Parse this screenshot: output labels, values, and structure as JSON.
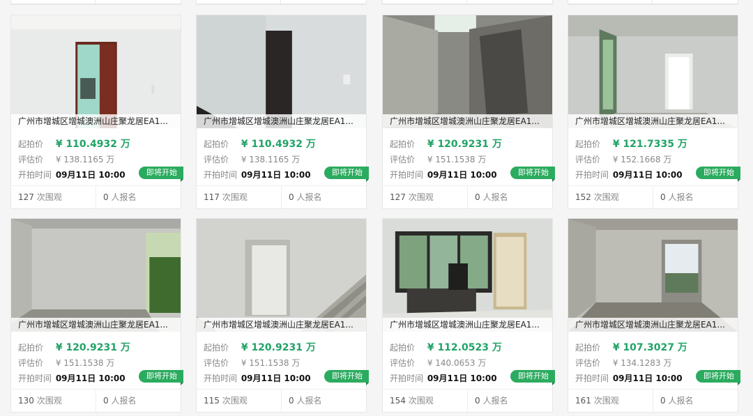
{
  "labels": {
    "start_price": "起拍价",
    "evaluation": "评估价",
    "start_time": "开拍时间",
    "views_suffix": "次围观",
    "signup_suffix": "人报名",
    "status": "即将开始"
  },
  "colors": {
    "accent_green": "#21a366",
    "badge_green": "#2bab5f"
  },
  "listings": [
    {
      "title": "广州市增城区增城澳洲山庄聚龙居EA1...",
      "start_price": "¥ 110.4932 万",
      "evaluation": "¥ 138.1165 万",
      "start_time": "09月11日 10:00",
      "views": "127",
      "signups": "0",
      "photo": "door-room"
    },
    {
      "title": "广州市增城区增城澳洲山庄聚龙居EA1...",
      "start_price": "¥ 110.4932 万",
      "evaluation": "¥ 138.1165 万",
      "start_time": "09月11日 10:00",
      "views": "117",
      "signups": "0",
      "photo": "dark-door"
    },
    {
      "title": "广州市增城区增城澳洲山庄聚龙居EA1...",
      "start_price": "¥ 120.9231 万",
      "evaluation": "¥ 151.1538 万",
      "start_time": "09月11日 10:00",
      "views": "127",
      "signups": "0",
      "photo": "concrete-wall"
    },
    {
      "title": "广州市增城区增城澳洲山庄聚龙居EA1...",
      "start_price": "¥ 121.7335 万",
      "evaluation": "¥ 152.1668 万",
      "start_time": "09月11日 10:00",
      "views": "152",
      "signups": "0",
      "photo": "corridor"
    },
    {
      "title": "广州市增城区增城澳洲山庄聚龙居EA1...",
      "start_price": "¥ 120.9231 万",
      "evaluation": "¥ 151.1538 万",
      "start_time": "09月11日 10:00",
      "views": "130",
      "signups": "0",
      "photo": "room-window"
    },
    {
      "title": "广州市增城区增城澳洲山庄聚龙居EA1...",
      "start_price": "¥ 120.9231 万",
      "evaluation": "¥ 151.1538 万",
      "start_time": "09月11日 10:00",
      "views": "115",
      "signups": "0",
      "photo": "stairs"
    },
    {
      "title": "广州市增城区增城澳洲山庄聚龙居EA1...",
      "start_price": "¥ 112.0523 万",
      "evaluation": "¥ 140.0653 万",
      "start_time": "09月11日 10:00",
      "views": "154",
      "signups": "0",
      "photo": "office"
    },
    {
      "title": "广州市增城区增城澳洲山庄聚龙居EA1...",
      "start_price": "¥ 107.3027 万",
      "evaluation": "¥ 134.1283 万",
      "start_time": "09月11日 10:00",
      "views": "161",
      "signups": "0",
      "photo": "open-room"
    }
  ]
}
